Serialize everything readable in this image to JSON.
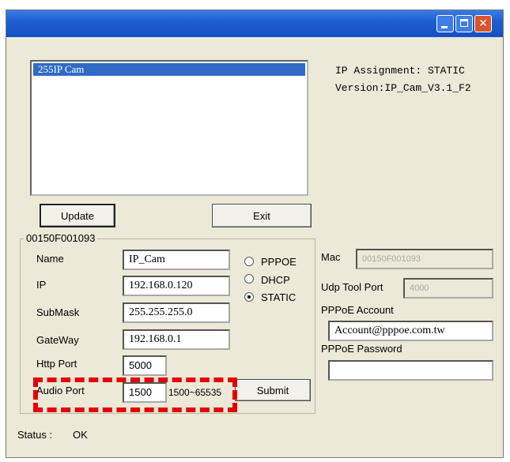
{
  "window": {
    "title": "",
    "controls": {
      "minimize": "minimize-icon",
      "maximize": "maximize-icon",
      "close": "close-icon",
      "close_glyph": "✕"
    }
  },
  "device_list": {
    "items": [
      "255IP Cam"
    ]
  },
  "info": {
    "ip_assignment": "IP Assignment: STATIC",
    "version": "Version:IP_Cam_V3.1_F2"
  },
  "buttons": {
    "update": "Update",
    "exit": "Exit",
    "submit": "Submit"
  },
  "group": {
    "title": "00150F001093",
    "name_label": "Name",
    "name_value": "IP_Cam",
    "ip_label": "IP",
    "ip_value": "192.168.0.120",
    "submask_label": "SubMask",
    "submask_value": "255.255.255.0",
    "gateway_label": "GateWay",
    "gateway_value": "192.168.0.1",
    "http_port_label": "Http Port",
    "http_port_value": "5000",
    "audio_port_label": "Audio Port",
    "audio_port_value": "1500",
    "audio_port_range": "1500~65535",
    "radio_options": [
      "PPPOE",
      "DHCP",
      "STATIC"
    ],
    "selected_mode": "STATIC"
  },
  "right_panel": {
    "mac_label": "Mac",
    "mac_value": "00150F001093",
    "udp_label": "Udp Tool Port",
    "udp_value": "4000",
    "pppoe_account_label": "PPPoE Account",
    "pppoe_account_value": "Account@pppoe.com.tw",
    "pppoe_password_label": "PPPoE Password",
    "pppoe_password_value": ""
  },
  "status": {
    "label": "Status :",
    "value": "OK"
  },
  "annotation": {
    "color": "#e60000"
  }
}
